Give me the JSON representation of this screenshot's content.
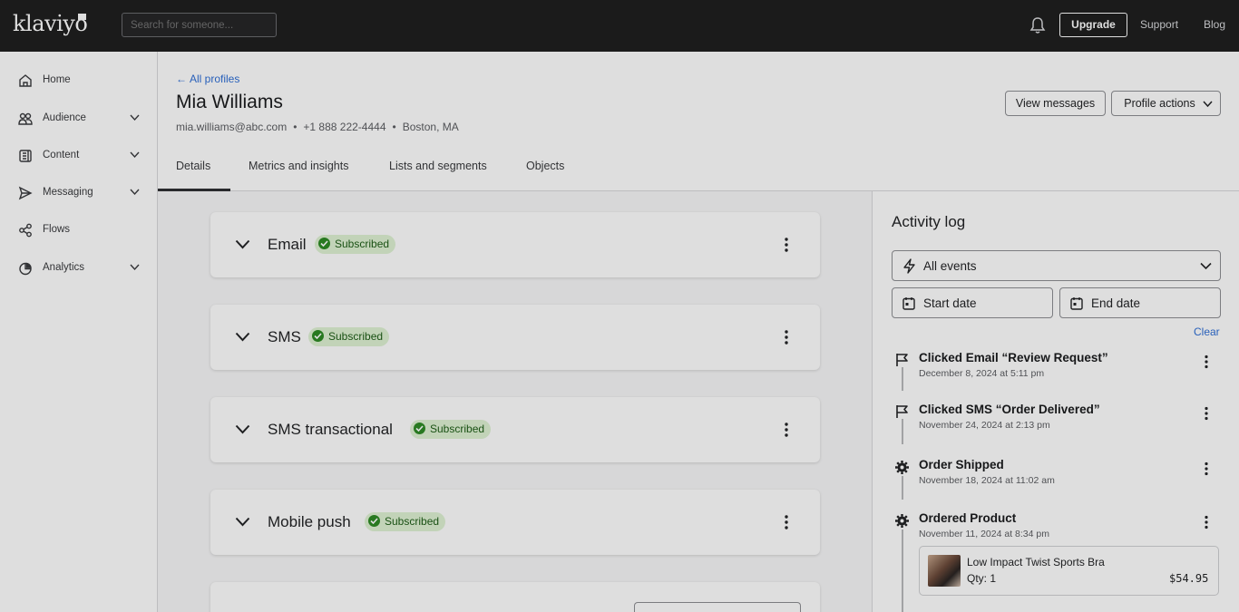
{
  "topbar": {
    "logo": "klaviyo",
    "search_placeholder": "Search for someone...",
    "upgrade_label": "Upgrade",
    "support_label": "Support",
    "blog_label": "Blog"
  },
  "sidebar": {
    "items": [
      {
        "label": "Home",
        "icon": "home-icon",
        "has_chevron": false
      },
      {
        "label": "Audience",
        "icon": "audience-icon",
        "has_chevron": true
      },
      {
        "label": "Content",
        "icon": "content-icon",
        "has_chevron": true
      },
      {
        "label": "Messaging",
        "icon": "send-icon",
        "has_chevron": true
      },
      {
        "label": "Flows",
        "icon": "flows-icon",
        "has_chevron": false
      },
      {
        "label": "Analytics",
        "icon": "analytics-icon",
        "has_chevron": true
      }
    ]
  },
  "profile": {
    "back_label": "All profiles",
    "name": "Mia Williams",
    "email": "mia.williams@abc.com",
    "phone": "+1 888 222-4444",
    "location": "Boston, MA",
    "view_messages_label": "View messages",
    "profile_actions_label": "Profile actions"
  },
  "tabs": [
    {
      "label": "Details",
      "active": true
    },
    {
      "label": "Metrics and insights",
      "active": false
    },
    {
      "label": "Lists and segments",
      "active": false
    },
    {
      "label": "Objects",
      "active": false
    }
  ],
  "channels": [
    {
      "title": "Email",
      "status": "Subscribed"
    },
    {
      "title": "SMS",
      "status": "Subscribed"
    },
    {
      "title": "SMS transactional",
      "status": "Subscribed"
    },
    {
      "title": "Mobile push",
      "status": "Subscribed"
    }
  ],
  "activity": {
    "title": "Activity log",
    "filter_label": "All events",
    "start_date_label": "Start date",
    "end_date_label": "End date",
    "clear_label": "Clear",
    "events": [
      {
        "title": "Clicked Email “Review Request”",
        "time": "December 8, 2024 at 5:11 pm",
        "icon": "flag-icon"
      },
      {
        "title": "Clicked SMS “Order Delivered”",
        "time": "November 24, 2024 at 2:13 pm",
        "icon": "flag-icon"
      },
      {
        "title": "Order Shipped",
        "time": "November 18, 2024 at 11:02 am",
        "icon": "gear-icon"
      },
      {
        "title": "Ordered Product",
        "time": "November 11, 2024 at 8:34 pm",
        "icon": "gear-icon"
      }
    ],
    "product": {
      "name": "Low Impact Twist Sports Bra",
      "qty": "Qty: 1",
      "price": "$54.95"
    }
  },
  "colors": {
    "topbar_bg": "#1f1f20",
    "link": "#2f6fd6",
    "badge_bg": "#dff3d4",
    "badge_text": "#1e5d17",
    "badge_icon": "#2e8b25"
  }
}
